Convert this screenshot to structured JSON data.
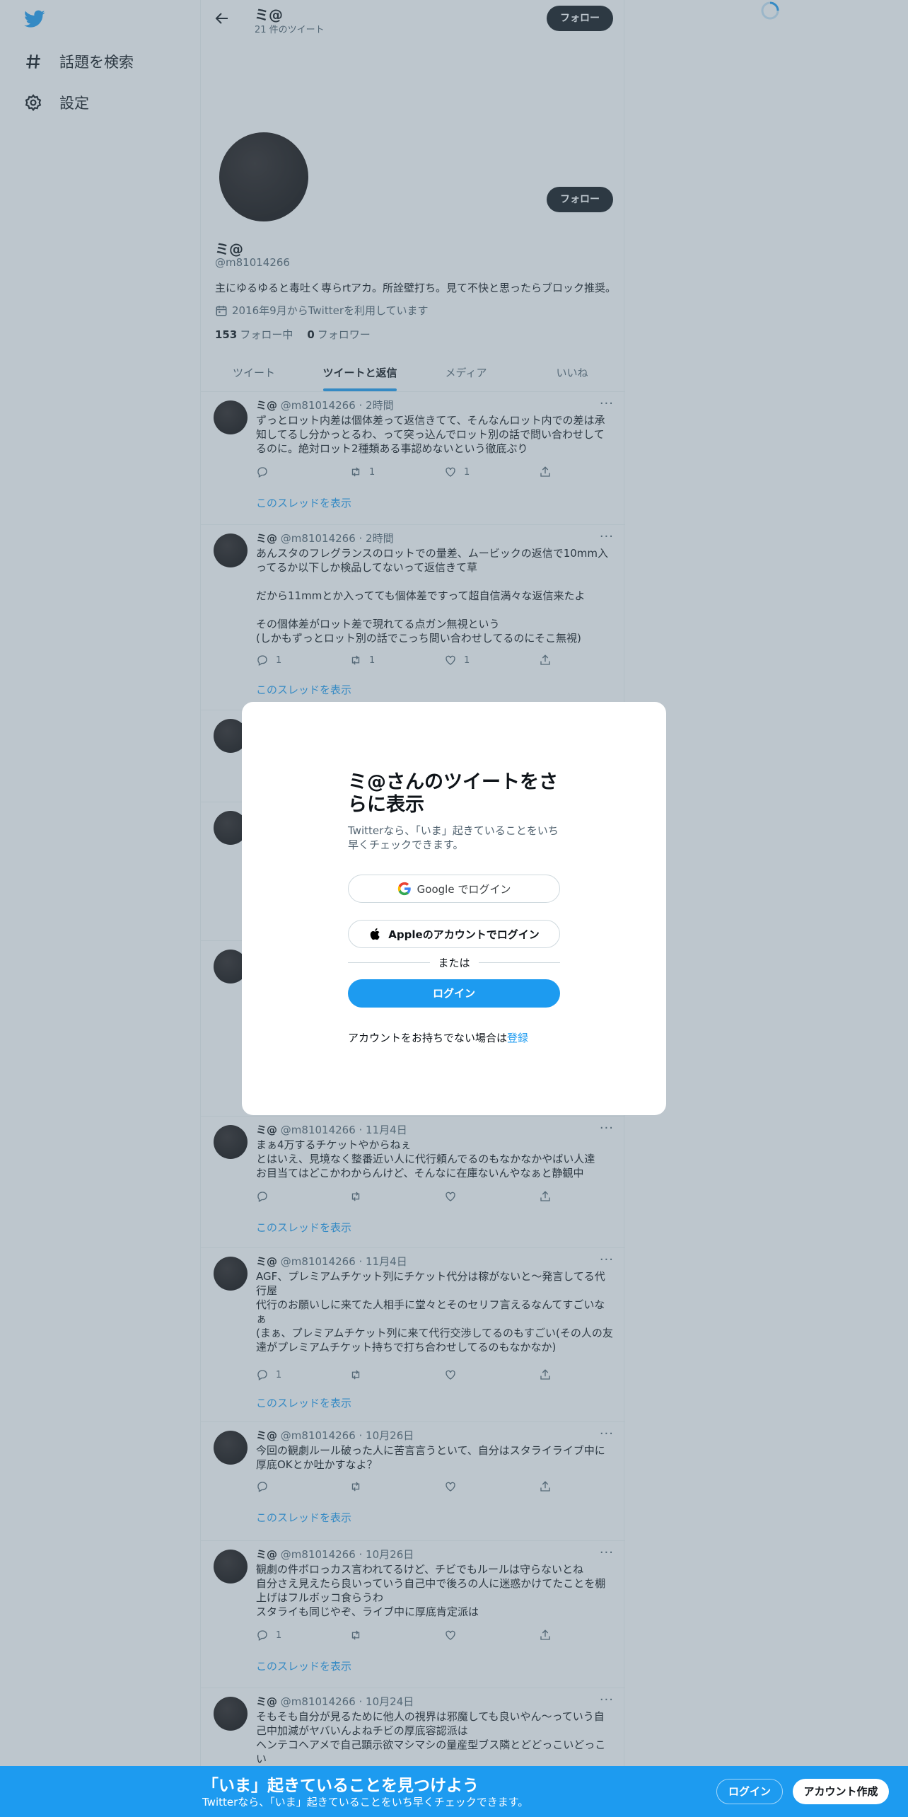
{
  "nav": {
    "explore_label": "話題を検索",
    "settings_label": "設定"
  },
  "header": {
    "name": "ミ@",
    "tweet_count": "21 件のツイート",
    "follow_label": "フォロー"
  },
  "profile": {
    "name": "ミ@",
    "handle": "@m81014266",
    "bio": "主にゆるゆると毒吐く専らrtアカ。所詮壁打ち。見て不快と思ったらブロック推奨。",
    "joined": "2016年9月からTwitterを利用しています",
    "following_count": "153",
    "following_label": "フォロー中",
    "followers_count": "0",
    "followers_label": "フォロワー",
    "follow_label": "フォロー"
  },
  "tabs": [
    "ツイート",
    "ツイートと返信",
    "メディア",
    "いいね"
  ],
  "tweets": [
    {
      "name": "ミ@",
      "meta": "@m81014266 · 2時間",
      "text": "ずっとロット内差は個体差って返信きてて、そんなんロット内での差は承知してるし分かっとるわ、って突っ込んでロット別の話で問い合わせしてるのに。絶対ロット2種類ある事認めないという徹底ぶり",
      "replies": "",
      "retweets": "1",
      "likes": "1",
      "thread": "このスレッドを表示"
    },
    {
      "name": "ミ@",
      "meta": "@m81014266 · 2時間",
      "text": "あんスタのフレグランスのロットでの量差、ムービックの返信で10mm入ってるか以下しか検品してないって返信きて草\n\nだから11mmとか入ってても個体差ですって超自信満々な返信来たよ\n\nその個体差がロット差で現れてる点ガン無視という\n(しかもずっとロット別の話でこっち問い合わせしてるのにそこ無視)",
      "replies": "1",
      "retweets": "1",
      "likes": "1",
      "thread": "このスレッドを表示"
    },
    {
      "name": "ミ@",
      "meta": "@m81014266 · 11月4日",
      "text": "まぁ4万するチケットやからねぇ\nとはいえ、見境なく整番近い人に代行頼んでるのもなかなかやばい人達\nお目当てはどこかわからんけど、そんなに在庫ないんやなぁと静観中",
      "replies": "",
      "retweets": "",
      "likes": "",
      "thread": "このスレッドを表示"
    },
    {
      "name": "ミ@",
      "meta": "@m81014266 · 11月4日",
      "text": "AGF、プレミアムチケット列にチケット代分は稼がないと〜発言してる代行屋\n代行のお願いしに来てた人相手に堂々とそのセリフ言えるなんてすごいなぁ\n(まぁ、プレミアムチケット列に来て代行交渉してるのもすごい(その人の友達がプレミアムチケット持ちで打ち合わせしてるのもなかなか)",
      "replies": "1",
      "retweets": "",
      "likes": "",
      "thread": "このスレッドを表示"
    },
    {
      "name": "ミ@",
      "meta": "@m81014266 · 10月26日",
      "text": "今回の観劇ルール破った人に苦言言うといて、自分はスタライライブ中に厚底OKとか吐かすなよ？",
      "replies": "",
      "retweets": "",
      "likes": "",
      "thread": "このスレッドを表示"
    },
    {
      "name": "ミ@",
      "meta": "@m81014266 · 10月26日",
      "text": "観劇の件ボロっカス言われてるけど、チビでもルールは守らないとね\n自分さえ見えたら良いっていう自己中で後ろの人に迷惑かけてたことを棚上げはフルボッコ食らうわ\nスタライも同じやぞ、ライブ中に厚底肯定派は",
      "replies": "1",
      "retweets": "",
      "likes": "",
      "thread": "このスレッドを表示"
    },
    {
      "name": "ミ@",
      "meta": "@m81014266 · 10月24日",
      "text": "そもそも自分が見るために他人の視界は邪魔しても良いやん〜っていう自己中加減がヤバいんよねチビの厚底容認派は\nヘンテコヘアメで自己顕示欲マシマシの量産型ブス隣とどどっこいどっこい",
      "replies": "",
      "retweets": "",
      "likes": "",
      "thread": ""
    }
  ],
  "modal": {
    "title": "ミ@さんのツイートをさらに表示",
    "subtitle": "Twitterなら、「いま」起きていることをいち早くチェックできます。",
    "google_label": "Google でログイン",
    "apple_label": "Appleのアカウントでログイン",
    "or_label": "または",
    "login_label": "ログイン",
    "signup_prefix": "アカウントをお持ちでない場合は",
    "signup_link": "登録"
  },
  "bottom_bar": {
    "title": "「いま」起きていることを見つけよう",
    "subtitle": "Twitterなら、「いま」起きていることをいち早くチェックできます。",
    "login_label": "ログイン",
    "signup_label": "アカウント作成"
  },
  "colors": {
    "accent": "#1d9bf0",
    "text": "#0f1419",
    "muted": "#536471",
    "overlay": "rgba(91,112,131,0.4)"
  }
}
